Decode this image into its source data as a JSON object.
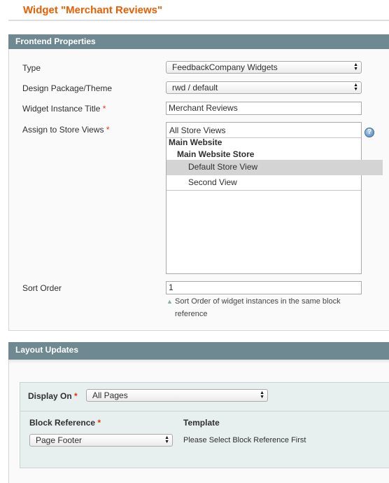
{
  "page": {
    "title": "Widget \"Merchant Reviews\""
  },
  "frontend": {
    "heading": "Frontend Properties",
    "type": {
      "label": "Type",
      "value": "FeedbackCompany Widgets"
    },
    "theme": {
      "label": "Design Package/Theme",
      "value": "rwd / default"
    },
    "instance_title": {
      "label": "Widget Instance Title",
      "value": "Merchant Reviews"
    },
    "store_views": {
      "label": "Assign to Store Views",
      "options": [
        "All Store Views",
        "Main Website",
        "Main Website Store",
        "Default Store View",
        "Second View"
      ],
      "selected": "Default Store View"
    },
    "sort_order": {
      "label": "Sort Order",
      "value": "1",
      "note_line1": "Sort Order of widget instances in the same block",
      "note_line2": "reference"
    },
    "required_mark": "*"
  },
  "layout": {
    "heading": "Layout Updates",
    "display_on": {
      "label": "Display On",
      "value": "All Pages"
    },
    "block_reference": {
      "label": "Block Reference",
      "value": "Page Footer"
    },
    "template": {
      "label": "Template",
      "value": "Please Select Block Reference First"
    }
  },
  "icons": {
    "help": "help-icon",
    "select_arrows": "select-arrows-icon",
    "note": "triangle-icon"
  },
  "colors": {
    "title": "#eb5e00",
    "section_header": "#6f8992",
    "required": "#eb340a",
    "selected_option": "#d4d4d4"
  }
}
